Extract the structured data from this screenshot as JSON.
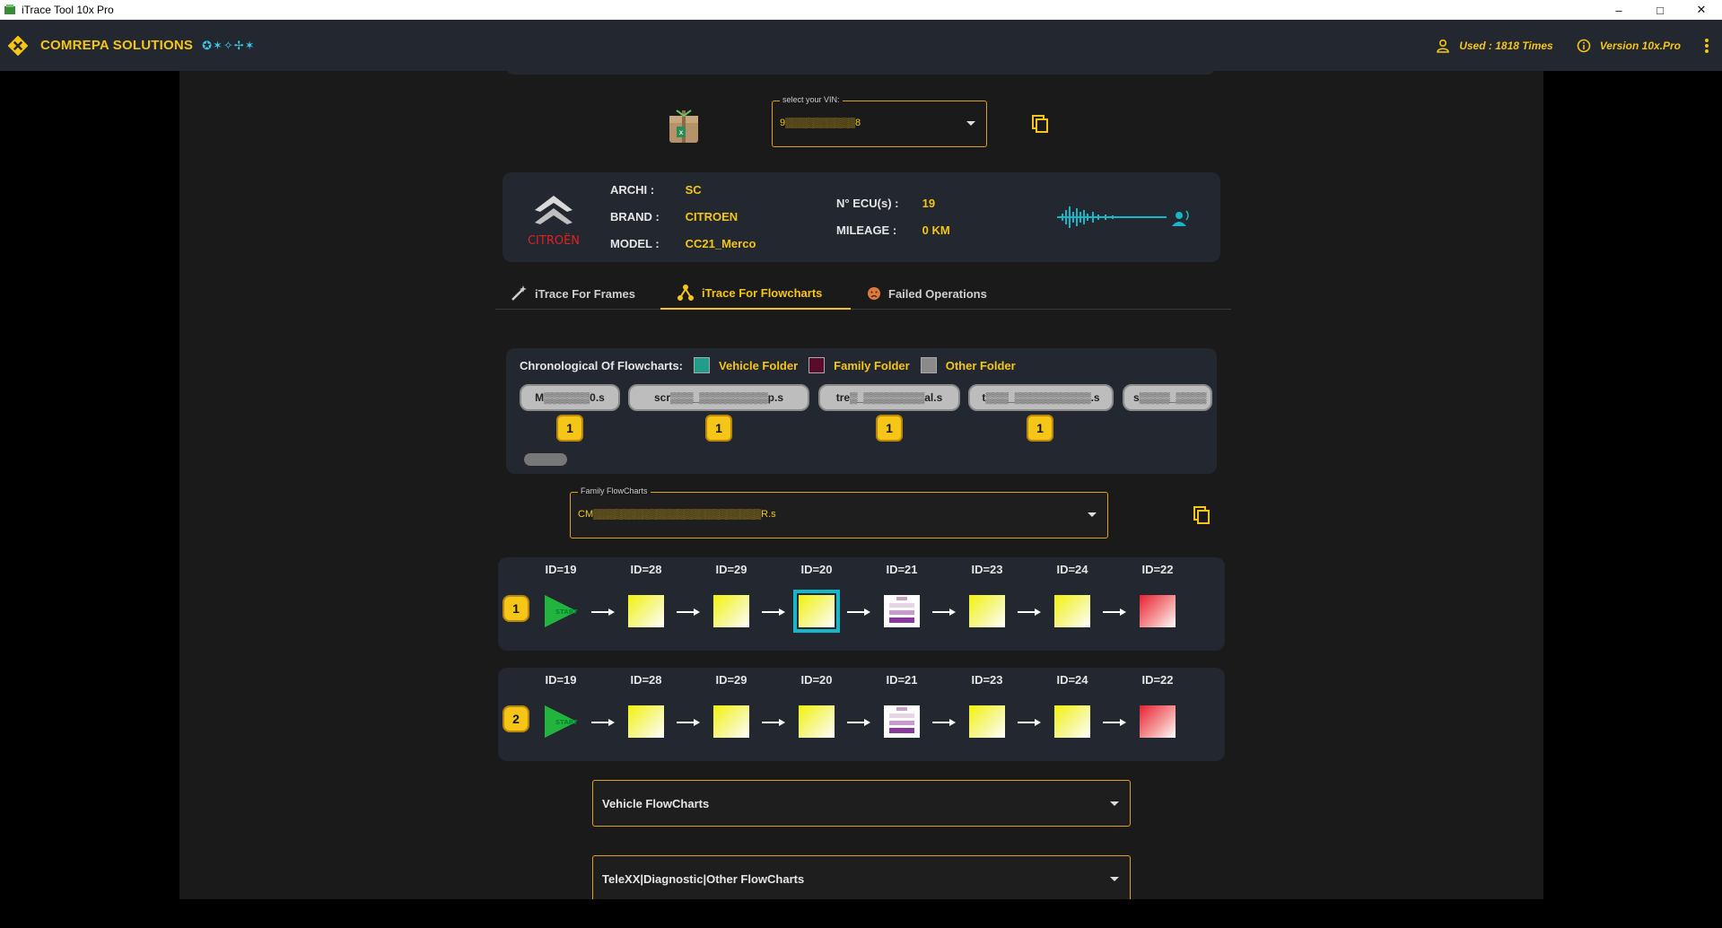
{
  "window": {
    "title": "iTrace Tool 10x Pro",
    "controls": [
      "–",
      "□",
      "✕"
    ]
  },
  "header": {
    "brand": "COMREPA SOLUTIONS",
    "stars": "✪✶✧✢✶",
    "used": "Used : 1818 Times",
    "version": "Version 10x.Pro"
  },
  "vin": {
    "label": "select your VIN:",
    "value": "9▒▒▒▒▒▒▒▒▒▒8"
  },
  "vehicle": {
    "archi_label": "ARCHI :",
    "archi": "SC",
    "brand_label": "BRAND :",
    "brand": "CITROEN",
    "model_label": "MODEL :",
    "model": "CC21_Merco",
    "ecu_label": "N° ECU(s) :",
    "ecu": "19",
    "mileage_label": "MILEAGE :",
    "mileage": "0 KM",
    "logo_text": "CITROËN"
  },
  "tabs": [
    {
      "label": "iTrace For Frames"
    },
    {
      "label": "iTrace For Flowcharts"
    },
    {
      "label": "Failed Operations"
    }
  ],
  "chrono": {
    "title": "Chronological Of Flowcharts:",
    "legend": [
      {
        "label": "Vehicle Folder",
        "color": "#1f9e8a"
      },
      {
        "label": "Family Folder",
        "color": "#5a0a2a"
      },
      {
        "label": "Other Folder",
        "color": "#8a8a8a"
      }
    ],
    "chips": [
      {
        "label": "M▒▒▒▒▒▒0.s",
        "count": "1"
      },
      {
        "label": "scr▒▒▒_▒▒▒▒▒▒▒▒▒p.s",
        "count": "1"
      },
      {
        "label": "tre▒_▒▒▒▒▒▒▒▒al.s",
        "count": "1"
      },
      {
        "label": "t▒▒▒_▒▒▒▒▒▒▒▒▒▒.s",
        "count": "1"
      },
      {
        "label": "s▒▒▒▒_▒▒▒▒",
        "count": ""
      }
    ]
  },
  "family": {
    "label": "Family FlowCharts",
    "value": "CM▒▒▒▒▒▒▒▒▒▒▒▒▒▒▒▒▒▒▒▒▒▒▒▒R.s"
  },
  "flows": [
    {
      "index": "1",
      "nodes": [
        {
          "id": "ID=19",
          "kind": "start",
          "label": "START"
        },
        {
          "id": "ID=28",
          "kind": "yellow"
        },
        {
          "id": "ID=29",
          "kind": "yellow"
        },
        {
          "id": "ID=20",
          "kind": "yellow",
          "selected": true
        },
        {
          "id": "ID=21",
          "kind": "purple"
        },
        {
          "id": "ID=23",
          "kind": "yellow"
        },
        {
          "id": "ID=24",
          "kind": "yellow"
        },
        {
          "id": "ID=22",
          "kind": "red"
        }
      ]
    },
    {
      "index": "2",
      "nodes": [
        {
          "id": "ID=19",
          "kind": "start",
          "label": "START"
        },
        {
          "id": "ID=28",
          "kind": "yellow"
        },
        {
          "id": "ID=29",
          "kind": "yellow"
        },
        {
          "id": "ID=20",
          "kind": "yellow"
        },
        {
          "id": "ID=21",
          "kind": "purple"
        },
        {
          "id": "ID=23",
          "kind": "yellow"
        },
        {
          "id": "ID=24",
          "kind": "yellow"
        },
        {
          "id": "ID=22",
          "kind": "red"
        }
      ]
    }
  ],
  "dropdowns": {
    "vehicle": "Vehicle FlowCharts",
    "other": "TeleXX|Diagnostic|Other FlowCharts"
  }
}
